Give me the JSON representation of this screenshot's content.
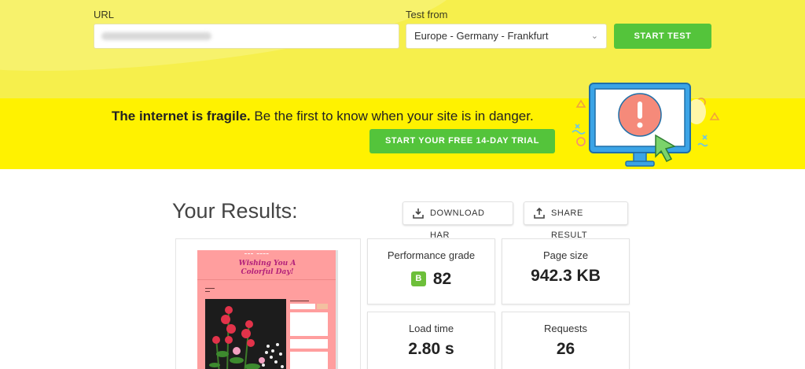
{
  "form": {
    "url_label": "URL",
    "url_value": "",
    "test_from_label": "Test from",
    "test_from_selected": "Europe - Germany - Frankfurt",
    "start_button": "START TEST"
  },
  "promo": {
    "headline_bold": "The internet is fragile.",
    "headline_rest": " Be the first to know when your site is in danger.",
    "cta_button": "START YOUR FREE 14-DAY TRIAL",
    "illustration_icon": "monitor-alert-icon"
  },
  "results": {
    "title": "Your Results:",
    "download_har": "DOWNLOAD HAR",
    "share_result": "SHARE RESULT",
    "preview": {
      "title_line1": "Wishing You A",
      "title_line2": "Colorful Day!"
    },
    "metrics": {
      "grade": {
        "label": "Performance grade",
        "letter": "B",
        "value": "82"
      },
      "page_size": {
        "label": "Page size",
        "value": "942.3 KB"
      },
      "load_time": {
        "label": "Load time",
        "value": "2.80 s"
      },
      "requests": {
        "label": "Requests",
        "value": "26"
      }
    }
  },
  "colors": {
    "top_band": "#f6ef4c",
    "promo_band": "#fff200",
    "green_button": "#54c43b",
    "grade_badge": "#6dbf3a",
    "preview_bg": "#ff9e9e"
  }
}
